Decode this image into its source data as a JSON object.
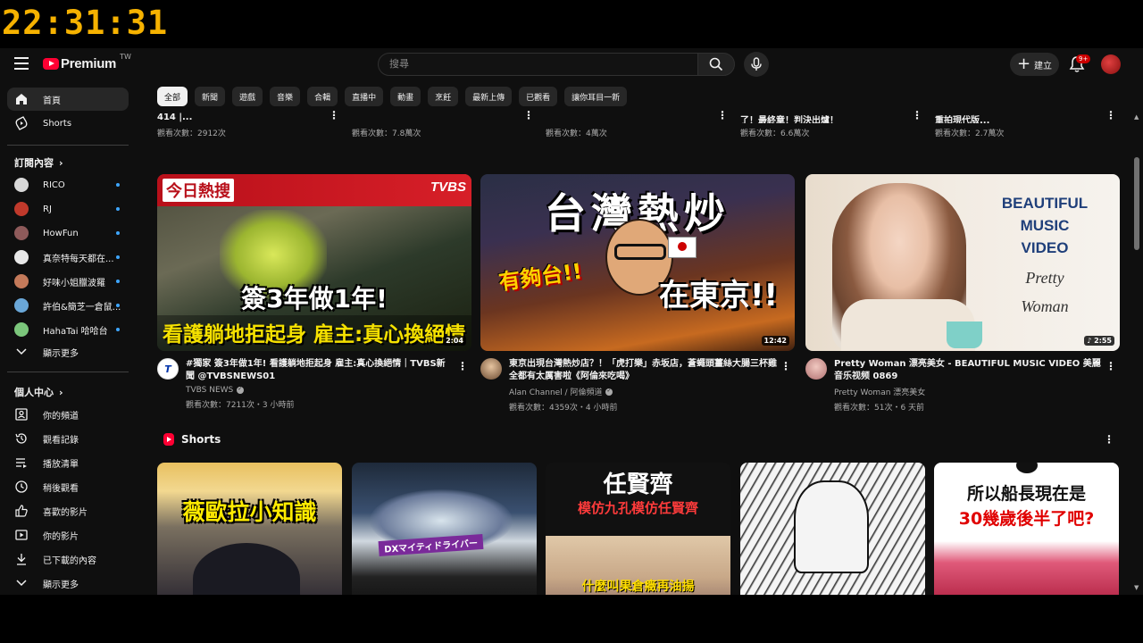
{
  "overlay_clock": "22:31:31",
  "header": {
    "logo_text": "Premium",
    "logo_region": "TW",
    "search_placeholder": "搜尋",
    "create_label": "建立",
    "notifications_badge": "9+"
  },
  "sidebar": {
    "main": [
      {
        "label": "首頁",
        "icon": "home-icon",
        "active": true
      },
      {
        "label": "Shorts",
        "icon": "shorts-icon",
        "active": false
      }
    ],
    "subscriptions_header": "訂閱內容",
    "subscriptions": [
      {
        "label": "RICO",
        "color": "#d8d8d8"
      },
      {
        "label": "RJ",
        "color": "#c0392b"
      },
      {
        "label": "HowFun",
        "color": "#8e5a5a"
      },
      {
        "label": "真奈特每天都在...",
        "color": "#e8e8e8"
      },
      {
        "label": "好味小姐臘波羅",
        "color": "#c47a5a"
      },
      {
        "label": "許伯&簡芝一倉鼠...",
        "color": "#6aa7d8"
      },
      {
        "label": "HahaTai 哈哈台",
        "color": "#7bc67b"
      }
    ],
    "subscriptions_more": "顯示更多",
    "you_header": "個人中心",
    "you_items": [
      {
        "label": "你的頻道",
        "icon": "channel-icon"
      },
      {
        "label": "觀看記錄",
        "icon": "history-icon"
      },
      {
        "label": "播放清單",
        "icon": "playlist-icon"
      },
      {
        "label": "稍後觀看",
        "icon": "watch-later-icon"
      },
      {
        "label": "喜歡的影片",
        "icon": "like-icon"
      },
      {
        "label": "你的影片",
        "icon": "your-videos-icon"
      },
      {
        "label": "已下載的內容",
        "icon": "download-icon"
      }
    ],
    "you_more": "顯示更多"
  },
  "chips": [
    "全部",
    "新聞",
    "遊戲",
    "音樂",
    "合輯",
    "直播中",
    "動畫",
    "烹飪",
    "最新上傳",
    "已觀看",
    "讓你耳目一新"
  ],
  "previous_row": [
    {
      "title": "414 |...",
      "views": "觀看次數：2912次"
    },
    {
      "title": "",
      "views": "觀看次數：7.8萬次"
    },
    {
      "title": "",
      "views": "觀看次數：4萬次"
    },
    {
      "title": "了！最終章！判決出爐！",
      "views": "觀看次數：6.6萬次"
    },
    {
      "title": "重拍現代版...",
      "views": "觀看次數：2.7萬次"
    }
  ],
  "videos": [
    {
      "title": "#獨家 簽3年做1年! 看護躺地拒起身 雇主:真心換絕情｜TVBS新聞 @TVBSNEWS01",
      "channel": "TVBS NEWS",
      "verified": true,
      "stats": "觀看次數：7211次・3 小時前",
      "duration": "2:04",
      "thumb_badge": "今日熱搜",
      "thumb_logo": "TVBS",
      "thumb_line1": "簽3年做1年!",
      "thumb_line2": "看護躺地拒起身 雇主:真心換絕情"
    },
    {
      "title": "東京出現台灣熱炒店？！「虎打樂」赤坂店，蒼蠅頭薑絲大腸三杯雞全都有太厲害啦《阿倫來吃喝》",
      "channel": "Alan Channel / 阿倫頻道",
      "verified": true,
      "stats": "觀看次數：4359次・4 小時前",
      "duration": "12:42",
      "thumb_line1": "台灣熱炒",
      "thumb_line2": "有夠台!!",
      "thumb_line3": "在東京!!"
    },
    {
      "title": "Pretty Woman 漂亮美女 - BEAUTIFUL MUSIC VIDEO 美麗音乐视频 0869",
      "channel": "Pretty Woman 漂亮美女",
      "verified": false,
      "stats": "觀看次數：51次・6 天前",
      "duration": "2:55",
      "thumb_line1": "BEAUTIFUL",
      "thumb_line2": "MUSIC",
      "thumb_line3": "VIDEO",
      "thumb_line4": "Pretty",
      "thumb_line5": "Woman"
    }
  ],
  "shorts": {
    "label": "Shorts",
    "items": [
      {
        "text": "薇歐拉小知識"
      },
      {
        "text": "DXマイティドライバー"
      },
      {
        "text": "任賢齊",
        "text2": "模仿九孔模仿任賢齊",
        "text3": "什麼叫果倉癥再油揚"
      },
      {
        "text": ""
      },
      {
        "text": "所以船長現在是",
        "text2": "30幾歲後半了吧?"
      }
    ]
  }
}
